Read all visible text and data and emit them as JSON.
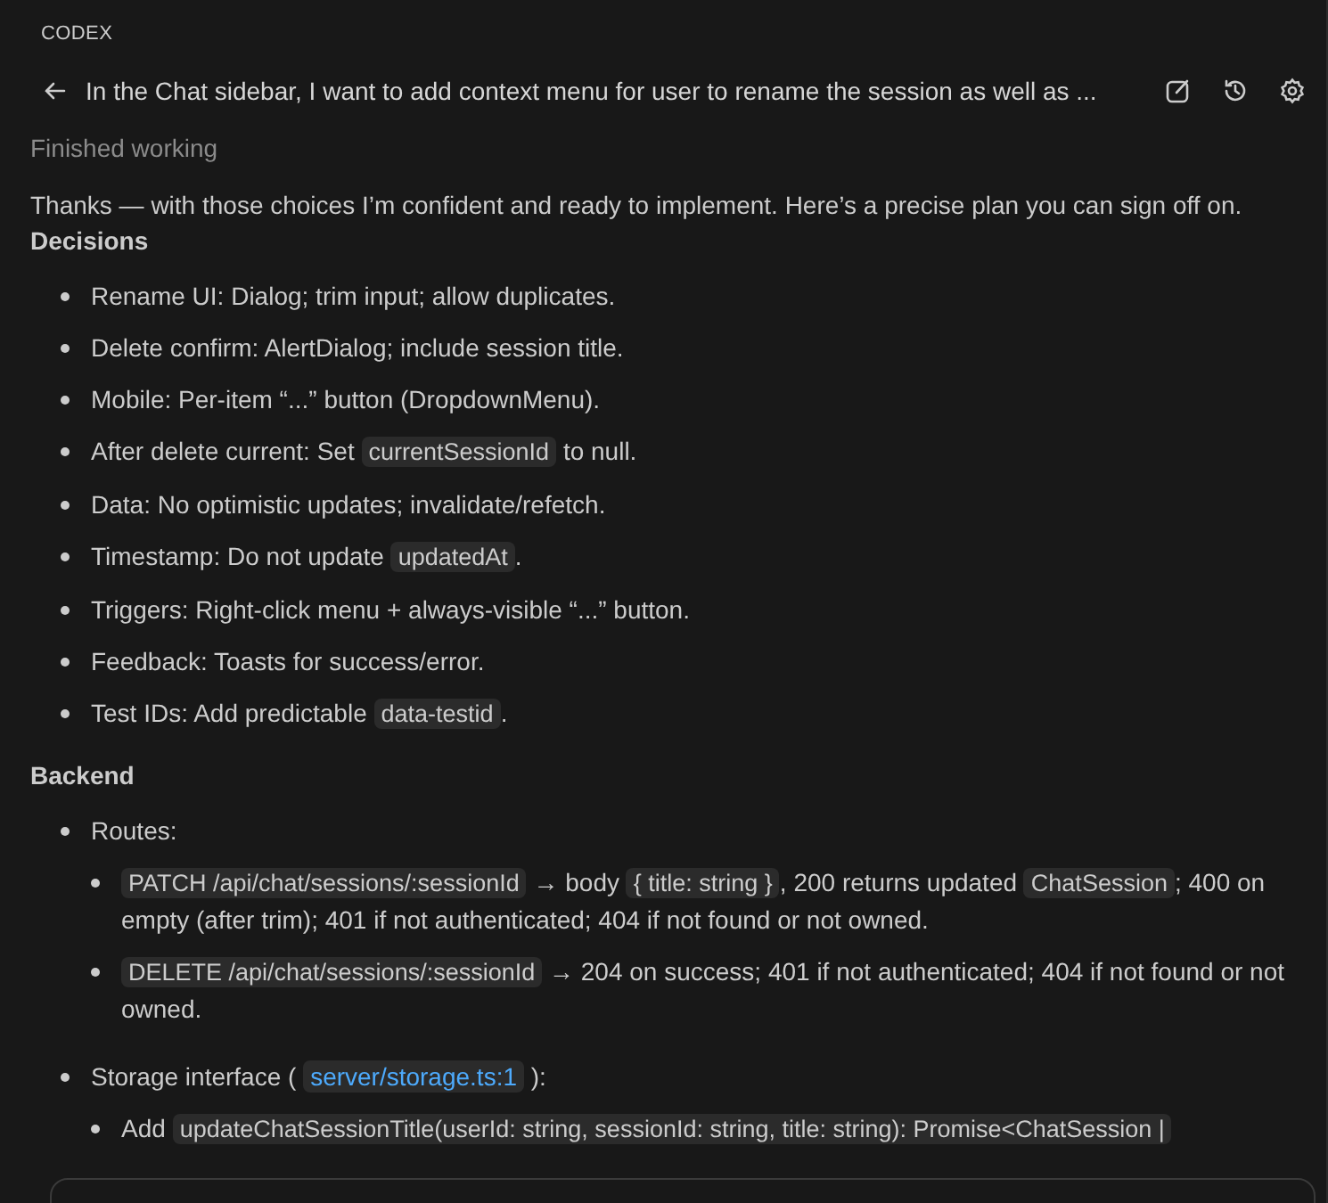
{
  "panel": {
    "label": "CODEX"
  },
  "header": {
    "title": "In the Chat sidebar, I want to add context menu for user to rename the session as well as ...",
    "actions": [
      {
        "kind": "edit"
      },
      {
        "kind": "history"
      },
      {
        "kind": "settings"
      }
    ]
  },
  "status": "Finished working",
  "blocks": [
    {
      "kind": "paragraph",
      "text": "Thanks — with those choices I’m confident and ready to implement. Here’s a precise plan you can sign off on."
    },
    {
      "kind": "heading",
      "text": "Decisions"
    },
    {
      "kind": "list",
      "items": [
        {
          "segments": [
            {
              "kind": "text",
              "text": "Rename UI: Dialog; trim input; allow duplicates."
            }
          ]
        },
        {
          "segments": [
            {
              "kind": "text",
              "text": "Delete confirm: AlertDialog; include session title."
            }
          ]
        },
        {
          "segments": [
            {
              "kind": "text",
              "text": "Mobile: Per-item “...” button (DropdownMenu)."
            }
          ]
        },
        {
          "segments": [
            {
              "kind": "text",
              "text": "After delete current: Set "
            },
            {
              "kind": "code",
              "text": "currentSessionId"
            },
            {
              "kind": "text",
              "text": " to null."
            }
          ]
        },
        {
          "segments": [
            {
              "kind": "text",
              "text": "Data: No optimistic updates; invalidate/refetch."
            }
          ]
        },
        {
          "segments": [
            {
              "kind": "text",
              "text": "Timestamp: Do not update "
            },
            {
              "kind": "code",
              "text": "updatedAt"
            },
            {
              "kind": "text",
              "text": "."
            }
          ]
        },
        {
          "segments": [
            {
              "kind": "text",
              "text": "Triggers: Right-click menu + always-visible “...” button."
            }
          ]
        },
        {
          "segments": [
            {
              "kind": "text",
              "text": "Feedback: Toasts for success/error."
            }
          ]
        },
        {
          "segments": [
            {
              "kind": "text",
              "text": "Test IDs: Add predictable "
            },
            {
              "kind": "code",
              "text": "data-testid"
            },
            {
              "kind": "text",
              "text": "."
            }
          ]
        }
      ]
    },
    {
      "kind": "heading",
      "text": "Backend"
    },
    {
      "kind": "list",
      "items": [
        {
          "segments": [
            {
              "kind": "text",
              "text": "Routes:"
            }
          ],
          "children": [
            {
              "segments": [
                {
                  "kind": "code",
                  "text": "PATCH /api/chat/sessions/:sessionId"
                },
                {
                  "kind": "text",
                  "text": " → body "
                },
                {
                  "kind": "code",
                  "text": "{ title: string }"
                },
                {
                  "kind": "text",
                  "text": ", 200 returns updated "
                },
                {
                  "kind": "code",
                  "text": "ChatSession"
                },
                {
                  "kind": "text",
                  "text": "; 400 on empty (after trim); 401 if not authenticated; 404 if not found or not owned."
                }
              ]
            },
            {
              "segments": [
                {
                  "kind": "code",
                  "text": "DELETE /api/chat/sessions/:sessionId"
                },
                {
                  "kind": "text",
                  "text": " → 204 on success; 401 if not authenticated; 404 if not found or not owned."
                }
              ]
            }
          ]
        },
        {
          "segments": [
            {
              "kind": "text",
              "text": "Storage interface ( "
            },
            {
              "kind": "link",
              "text": "server/storage.ts:1"
            },
            {
              "kind": "text",
              "text": " ):"
            }
          ],
          "children": [
            {
              "segments": [
                {
                  "kind": "text",
                  "text": "Add "
                },
                {
                  "kind": "code",
                  "text": "updateChatSessionTitle(userId: string, sessionId: string, title: string): Promise<ChatSession |"
                }
              ]
            }
          ]
        }
      ]
    }
  ]
}
